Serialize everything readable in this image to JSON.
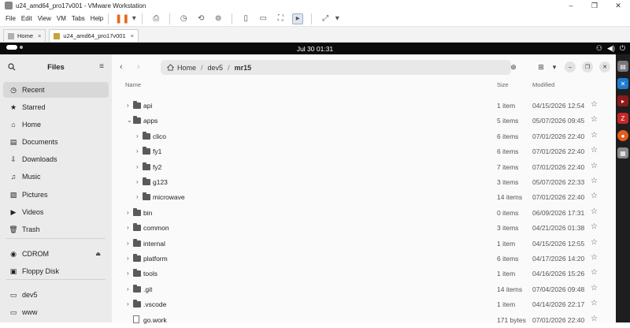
{
  "vmware": {
    "title": "u24_amd64_pro17v001 - VMware Workstation",
    "menu": [
      "File",
      "Edit",
      "View",
      "VM",
      "Tabs",
      "Help"
    ],
    "tabs": [
      {
        "label": "Home",
        "active": false
      },
      {
        "label": "u24_amd64_pro17v001",
        "active": true
      }
    ]
  },
  "topbar": {
    "clock": "Jul 30  01:31"
  },
  "files": {
    "title": "Files",
    "sidebar": [
      {
        "label": "Recent",
        "icon": "clock-icon",
        "selected": true
      },
      {
        "label": "Starred",
        "icon": "star-icon"
      },
      {
        "label": "Home",
        "icon": "home-icon"
      },
      {
        "label": "Documents",
        "icon": "document-icon"
      },
      {
        "label": "Downloads",
        "icon": "download-icon"
      },
      {
        "label": "Music",
        "icon": "music-icon"
      },
      {
        "label": "Pictures",
        "icon": "picture-icon"
      },
      {
        "label": "Videos",
        "icon": "video-icon"
      },
      {
        "label": "Trash",
        "icon": "trash-icon"
      },
      {
        "label": "CDROM",
        "icon": "disc-icon",
        "eject": true
      },
      {
        "label": "Floppy Disk",
        "icon": "floppy-icon"
      },
      {
        "label": "dev5",
        "icon": "folder-icon"
      },
      {
        "label": "www",
        "icon": "folder-icon"
      }
    ],
    "path": {
      "home": "Home",
      "segments": [
        "dev5",
        "mr15"
      ]
    },
    "columns": {
      "name": "Name",
      "size": "Size",
      "modified": "Modified"
    },
    "rows": [
      {
        "name": "api",
        "size": "1 item",
        "modified": "04/15/2026 12:54",
        "indent": 0,
        "expanded": false,
        "type": "folder"
      },
      {
        "name": "apps",
        "size": "5 items",
        "modified": "05/07/2026 09:45",
        "indent": 0,
        "expanded": true,
        "type": "folder"
      },
      {
        "name": "clico",
        "size": "6 items",
        "modified": "07/01/2026 22:40",
        "indent": 1,
        "expanded": false,
        "type": "folder"
      },
      {
        "name": "fy1",
        "size": "6 items",
        "modified": "07/01/2026 22:40",
        "indent": 1,
        "expanded": false,
        "type": "folder"
      },
      {
        "name": "fy2",
        "size": "7 items",
        "modified": "07/01/2026 22:40",
        "indent": 1,
        "expanded": false,
        "type": "folder"
      },
      {
        "name": "g123",
        "size": "3 items",
        "modified": "05/07/2026 22:33",
        "indent": 1,
        "expanded": false,
        "type": "folder"
      },
      {
        "name": "microwave",
        "size": "14 items",
        "modified": "07/01/2026 22:40",
        "indent": 1,
        "expanded": false,
        "type": "folder"
      },
      {
        "name": "bin",
        "size": "0 items",
        "modified": "06/09/2026 17:31",
        "indent": 0,
        "expanded": false,
        "type": "folder"
      },
      {
        "name": "common",
        "size": "3 items",
        "modified": "04/21/2026 01:38",
        "indent": 0,
        "expanded": false,
        "type": "folder"
      },
      {
        "name": "internal",
        "size": "1 item",
        "modified": "04/15/2026 12:55",
        "indent": 0,
        "expanded": false,
        "type": "folder"
      },
      {
        "name": "platform",
        "size": "6 items",
        "modified": "04/17/2026 14:20",
        "indent": 0,
        "expanded": false,
        "type": "folder"
      },
      {
        "name": "tools",
        "size": "1 item",
        "modified": "04/16/2026 15:26",
        "indent": 0,
        "expanded": false,
        "type": "folder"
      },
      {
        "name": ".git",
        "size": "14 items",
        "modified": "07/04/2026 09:48",
        "indent": 0,
        "expanded": false,
        "type": "folder"
      },
      {
        "name": ".vscode",
        "size": "1 item",
        "modified": "04/14/2026 22:17",
        "indent": 0,
        "expanded": false,
        "type": "folder"
      },
      {
        "name": "go.work",
        "size": "171 bytes",
        "modified": "07/01/2026 22:40",
        "indent": 0,
        "expanded": false,
        "type": "file"
      }
    ]
  },
  "colors": {
    "accent_pause": "#e8681a",
    "sidebar_bg": "#ebebeb",
    "topbar_bg": "#0b0b0b",
    "dock_bg": "#1e1e1e"
  }
}
